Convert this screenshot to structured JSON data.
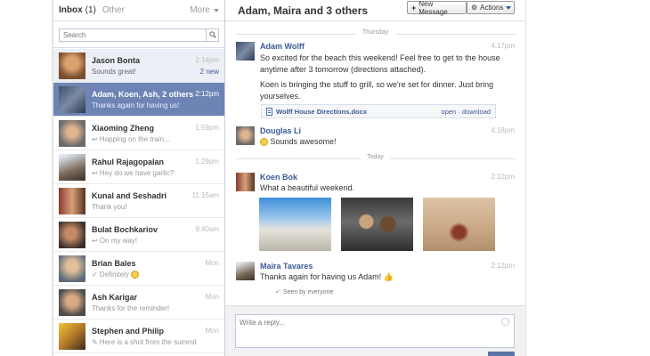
{
  "left": {
    "tab_inbox": "Inbox",
    "tab_inbox_count": "(1)",
    "tab_other": "Other",
    "more_label": "More",
    "search_placeholder": "Search",
    "threads": [
      {
        "name": "Jason Bonta",
        "snippet": "Sounds great!",
        "time": "2:14pm",
        "badge": "2 new",
        "state": "unread",
        "avatar": "av1"
      },
      {
        "name": "Adam, Koen, Ash, 2 others",
        "snippet": "Thanks again for having us!",
        "time": "2:12pm",
        "badge": "",
        "state": "selected",
        "avatar": "av2"
      },
      {
        "name": "Xiaoming Zheng",
        "snippet": "↩ Hopping on the train...",
        "time": "1:59pm",
        "badge": "",
        "state": "",
        "avatar": "av3"
      },
      {
        "name": "Rahul Rajagopalan",
        "snippet": "↩ Hey do we have garlic?",
        "time": "1:29pm",
        "badge": "",
        "state": "",
        "avatar": "av4"
      },
      {
        "name": "Kunal and Seshadri",
        "snippet": "Thank you!",
        "time": "11:15am",
        "badge": "",
        "state": "",
        "avatar": "av5"
      },
      {
        "name": "Bulat Bochkariov",
        "snippet": "↩ On my way!",
        "time": "9:40am",
        "badge": "",
        "state": "",
        "avatar": "av6"
      },
      {
        "name": "Brian Bales",
        "snippet": "✓ Definitely",
        "time": "Mon",
        "badge": "",
        "state": "",
        "avatar": "av7"
      },
      {
        "name": "Ash Karigar",
        "snippet": "Thanks for the reminder!",
        "time": "Mon",
        "badge": "",
        "state": "",
        "avatar": "av8"
      },
      {
        "name": "Stephen and Philip",
        "snippet": "✎ Here is a shot from the summit",
        "time": "Mon",
        "badge": "",
        "state": "",
        "avatar": "av9"
      }
    ]
  },
  "conversation": {
    "title": "Adam, Maira and 3 others",
    "new_message_label": "New Message",
    "actions_label": "Actions",
    "day_thursday": "Thursday",
    "day_today": "Today",
    "messages": {
      "adam": {
        "author": "Adam Wolff",
        "time": "4:17pm",
        "p1": "So excited for the beach this weekend! Feel free to get to the house anytime after 3 tomorrow (directions attached).",
        "p2": "Koen is bringing the stuff to grill, so we're set for dinner. Just bring yourselves.",
        "attachment_name": "Wolff House Directions.docx",
        "attachment_actions": "open · download"
      },
      "douglas": {
        "author": "Douglas Li",
        "time": "4:18pm",
        "text": "Sounds awesome!"
      },
      "koen": {
        "author": "Koen Bok",
        "time": "2:12pm",
        "text": "What a beautiful weekend."
      },
      "maira": {
        "author": "Maira Tavares",
        "time": "2:12pm",
        "text": "Thanks again for having us Adam!"
      }
    },
    "seen_text": "Seen by everyone",
    "reply_placeholder": "Write a reply..."
  }
}
